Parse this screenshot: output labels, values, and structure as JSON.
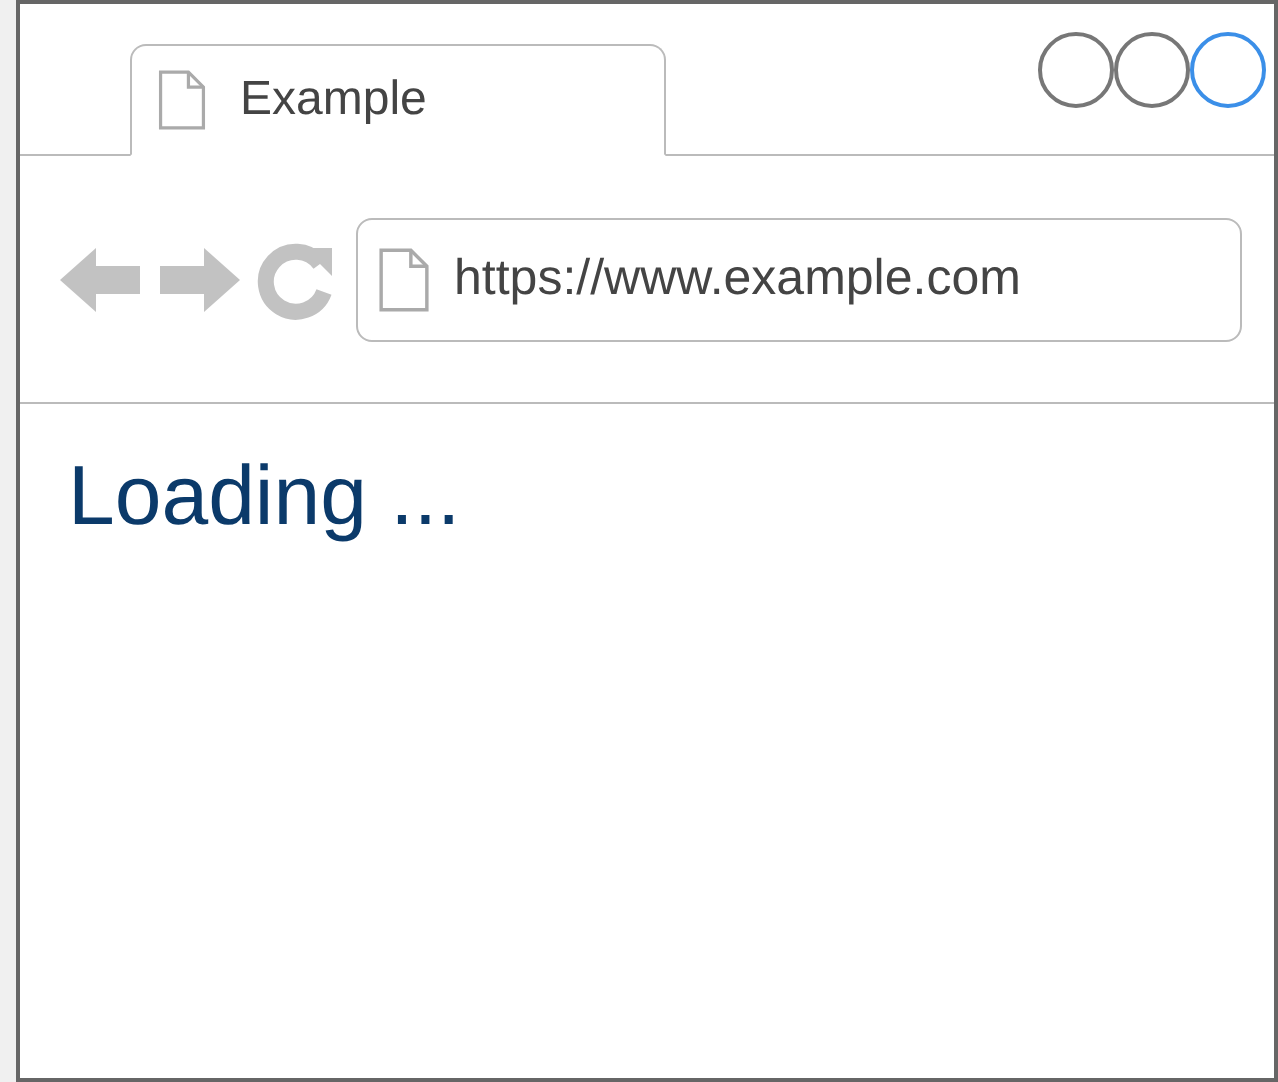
{
  "tab": {
    "title": "Example"
  },
  "window_buttons": [
    {
      "selected": false
    },
    {
      "selected": false
    },
    {
      "selected": true
    }
  ],
  "address_bar": {
    "value": "https://www.example.com"
  },
  "content": {
    "text": "Loading ..."
  }
}
